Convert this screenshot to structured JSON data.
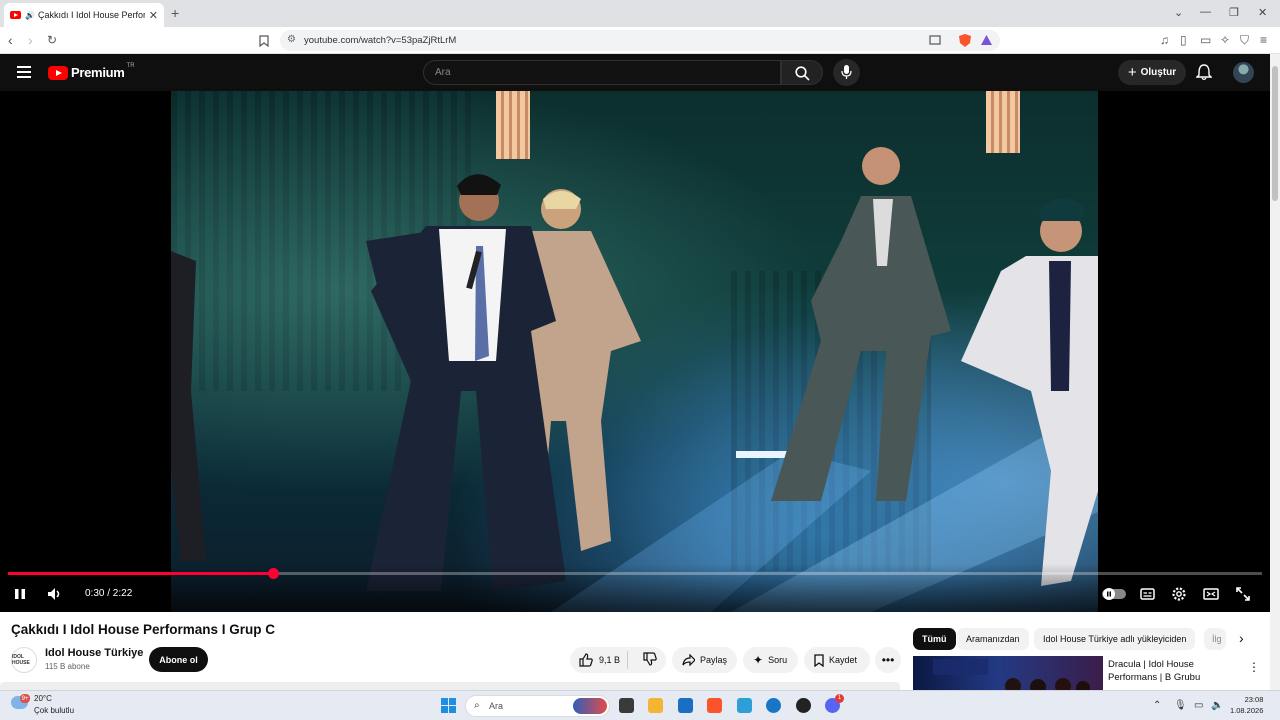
{
  "browser": {
    "tab_title": "Çakkıdı I Idol House Performa",
    "url": "youtube.com/watch?v=53paZjRtLrM"
  },
  "youtube": {
    "logo_text": "Premium",
    "logo_country": "TR",
    "search_placeholder": "Ara",
    "create_label": "Oluştur"
  },
  "player": {
    "current_time": "0:30",
    "duration": "2:22",
    "time_display": "0:30 / 2:22",
    "progress_fraction": 0.211
  },
  "video": {
    "title": "Çakkıdı I Idol House Performans I Grup C",
    "channel_name": "Idol House Türkiye",
    "channel_avatar_text": "IDOL HOUSE",
    "subscribers": "115 B abone",
    "subscribe_label": "Abone ol",
    "likes": "9,1 B",
    "share_label": "Paylaş",
    "ask_label": "Soru",
    "save_label": "Kaydet"
  },
  "recommendations": {
    "chips": [
      "Tümü",
      "Aramanızdan",
      "Idol House Türkiye adlı yükleyiciden",
      "İlg"
    ],
    "items": [
      {
        "title_line1": "Dracula | Idol House",
        "title_line2": "Performans | B Grubu"
      }
    ]
  },
  "taskbar": {
    "weather_badge": "9+",
    "temperature": "20°C",
    "weather_condition": "Çok bulutlu",
    "search_placeholder": "Ara",
    "discord_badge": "1",
    "time": "23:08",
    "date": "1.08.2026"
  },
  "colors": {
    "youtube_red": "#ff0000",
    "progress_red": "#ff0033",
    "header_bg": "#0f0f0f"
  }
}
